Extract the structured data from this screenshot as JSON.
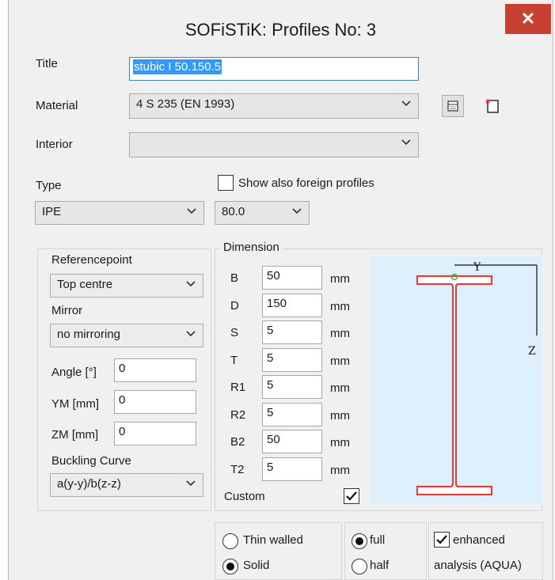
{
  "window": {
    "title": "SOFiSTiK: Profiles No:   3",
    "close_glyph": "✕"
  },
  "form": {
    "title_label": "Title",
    "title_value": "stubic I 50.150.5",
    "material_label": "Material",
    "material_value": "4 S 235 (EN 1993)",
    "interior_label": "Interior",
    "interior_value": "",
    "type_label": "Type",
    "show_foreign_label": "Show also foreign profiles",
    "show_foreign_checked": false,
    "type_value": "IPE",
    "size_value": "80.0"
  },
  "reference": {
    "referencepoint_label": "Referencepoint",
    "referencepoint_value": "Top centre",
    "mirror_label": "Mirror",
    "mirror_value": "no mirroring",
    "angle_label": "Angle [°]",
    "angle_value": "0",
    "ym_label": "YM [mm]",
    "ym_value": "0",
    "zm_label": "ZM [mm]",
    "zm_value": "0",
    "buckling_label": "Buckling Curve",
    "buckling_value": "a(y-y)/b(z-z)"
  },
  "dimension": {
    "legend": "Dimension",
    "rows": [
      {
        "label": "B",
        "value": "50",
        "unit": "mm"
      },
      {
        "label": "D",
        "value": "150",
        "unit": "mm"
      },
      {
        "label": "S",
        "value": "5",
        "unit": "mm"
      },
      {
        "label": "T",
        "value": "5",
        "unit": "mm"
      },
      {
        "label": "R1",
        "value": "5",
        "unit": "mm"
      },
      {
        "label": "R2",
        "value": "5",
        "unit": "mm"
      },
      {
        "label": "B2",
        "value": "50",
        "unit": "mm"
      },
      {
        "label": "T2",
        "value": "5",
        "unit": "mm"
      }
    ],
    "custom_label": "Custom",
    "custom_checked": true
  },
  "preview": {
    "y_axis_label": "Y",
    "z_axis_label": "Z",
    "profile_color": "#d64545",
    "background_color": "#ddf0fb"
  },
  "options": {
    "thin_walled_label": "Thin walled",
    "solid_label": "Solid",
    "wall_selected": "solid",
    "full_label": "full",
    "half_label": "half",
    "section_selected": "full",
    "enhanced_line1": "enhanced",
    "enhanced_line2": "analysis (AQUA)",
    "enhanced_checked": true
  }
}
